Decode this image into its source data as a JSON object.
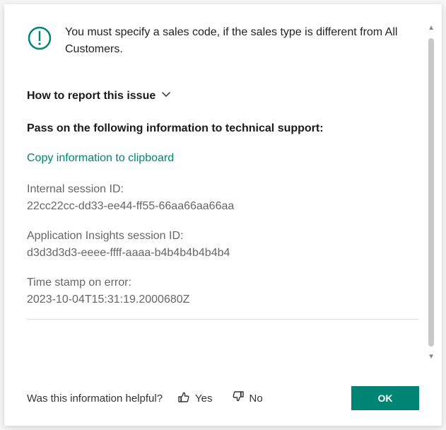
{
  "alert": {
    "message": "You must specify a sales code, if the sales type is different from All Customers."
  },
  "expand": {
    "label": "How to report this issue"
  },
  "support": {
    "heading": "Pass on the following information to technical support:",
    "copy_label": "Copy information to clipboard",
    "internal_session": {
      "label": "Internal session ID:",
      "value": "22cc22cc-dd33-ee44-ff55-66aa66aa66aa"
    },
    "app_insights": {
      "label": "Application Insights session ID:",
      "value": "d3d3d3d3-eeee-ffff-aaaa-b4b4b4b4b4b4"
    },
    "timestamp": {
      "label": "Time stamp on error:",
      "value": "2023-10-04T15:31:19.2000680Z"
    }
  },
  "footer": {
    "question": "Was this information helpful?",
    "yes_label": "Yes",
    "no_label": "No",
    "ok_label": "OK"
  },
  "colors": {
    "accent": "#008575"
  }
}
